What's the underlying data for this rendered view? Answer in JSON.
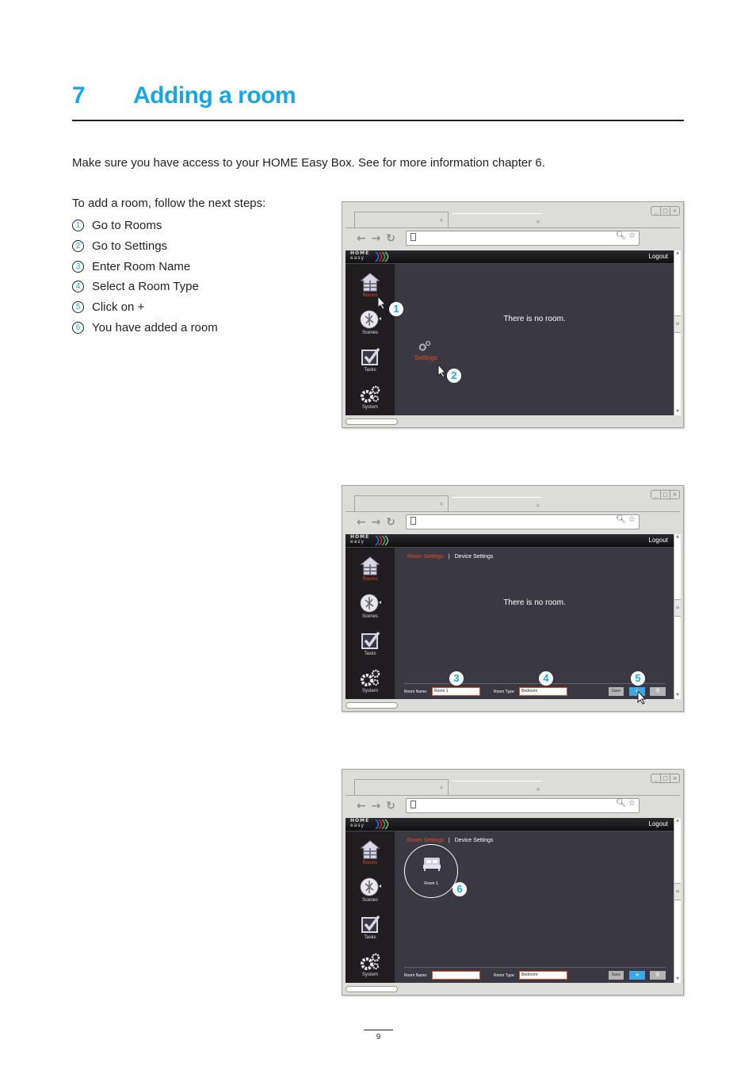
{
  "heading": {
    "number": "7",
    "title": "Adding a room"
  },
  "intro": "Make sure you have access to your HOME Easy Box. See for more information chapter 6.",
  "steps_intro": "To add a room, follow the next steps:",
  "steps": [
    {
      "n": "1",
      "label": "Go to Rooms"
    },
    {
      "n": "2",
      "label": "Go to Settings"
    },
    {
      "n": "3",
      "label": "Enter Room Name"
    },
    {
      "n": "4",
      "label": "Select a Room Type"
    },
    {
      "n": "5",
      "label": "Click on +"
    },
    {
      "n": "6",
      "label": "You have added a room"
    }
  ],
  "browser": {
    "tab_close": "×",
    "win_controls": [
      "_",
      "□",
      "×"
    ],
    "nav": "← → ↻",
    "url_icons": "🔍︎ ☆"
  },
  "app": {
    "logo_top": "HOME",
    "logo_bottom": "easy",
    "logout": "Logout",
    "sidebar": [
      "Rooms",
      "Scenes",
      "Tasks",
      "System"
    ],
    "no_room": "There is no room.",
    "settings": "Settings",
    "subnav": {
      "room_settings": "Room Settings",
      "sep": "|",
      "device_settings": "Device Settings"
    },
    "form": {
      "room_name_label": "Room Name:",
      "room_type_label": "Room Type:",
      "save": "Save",
      "add": "+",
      "delete": "🗑"
    }
  },
  "screens": [
    {
      "badges": [
        "1",
        "2"
      ]
    },
    {
      "room_name": "Room 1",
      "room_type": "Bedroom",
      "badges": [
        "3",
        "4",
        "5"
      ]
    },
    {
      "room_name": "",
      "room_type": "Bedroom",
      "room_tile": "Room 1",
      "badges": [
        "6"
      ]
    }
  ],
  "accent": "#1aa7df",
  "active_color": "#e8511f",
  "page_number": "9"
}
